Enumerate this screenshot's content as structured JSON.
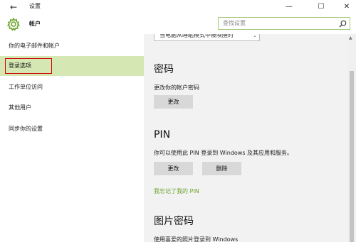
{
  "window": {
    "title": "设置",
    "back_glyph": "←",
    "minimize_glyph": "—",
    "maximize_glyph": "☐",
    "close_glyph": "✕"
  },
  "header": {
    "title": "帐户",
    "search_placeholder": "查找设置",
    "accent_color": "#6aa52b"
  },
  "sidebar": {
    "items": [
      {
        "label": "你的电子邮件和帐户"
      },
      {
        "label": "登录选项"
      },
      {
        "label": "工作单位访问"
      },
      {
        "label": "其他用户"
      },
      {
        "label": "同步你的设置"
      }
    ],
    "selected_index": 1,
    "selected_color": "#d5e7b3",
    "highlight_color": "#d00000"
  },
  "main": {
    "dropdown_value": "当电脑从睡眠模式中被唤醒时",
    "password": {
      "title": "密码",
      "desc": "更改你的帐户密码",
      "change_label": "更改"
    },
    "pin": {
      "title": "PIN",
      "desc": "你可以使用此 PIN 登录到 Windows 及其应用和服务。",
      "change_label": "更改",
      "remove_label": "删除",
      "forgot_link": "我忘记了我的 PIN"
    },
    "picture_password": {
      "title": "图片密码",
      "desc": "使用喜爱的照片登录到 Windows"
    }
  }
}
